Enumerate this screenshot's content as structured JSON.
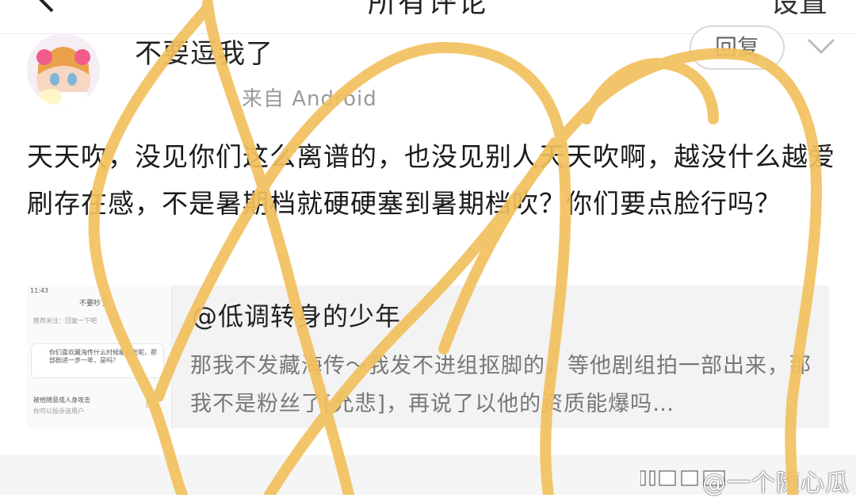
{
  "nav": {
    "title": "所有评论",
    "settings_label": "设置",
    "back_icon": "back-arrow-icon"
  },
  "comment": {
    "username": "不要逗我了",
    "source": "来自 Android",
    "reply_label": "回复",
    "menu_icon": "chevron-down-icon",
    "text": "天天吹，没见你们这么离谱的，也没见别人天天吹啊，越没什么越爱刷存在感，不是暑期档就硬硬塞到暑期档吹？你们要点脸行吗？"
  },
  "quote": {
    "user": "@低调转身的少年",
    "text": "那我不发藏海传～我发不进组抠脚的，等他剧组拍一部出来，那我不是粉丝了[允悲]，再说了以他的资质能爆吗…",
    "thumbnail": {
      "status_time": "11:43",
      "header_title": "不要吵了",
      "row1": "推荐关注：回复一下吧",
      "bubble_text": "你们喜欢藏海传什么时候能去发呢，那部剧进一步一年，是吗？",
      "row2": "被他随意成人身攻击",
      "row3": "你可以投诉该用户",
      "mini_reply": "回复"
    }
  },
  "watermark": {
    "text": "@一个随心瓜"
  },
  "colors": {
    "scribble": "#f2c15e",
    "meta": "#9a9a9a",
    "quote_bg": "#f3f3f3"
  }
}
